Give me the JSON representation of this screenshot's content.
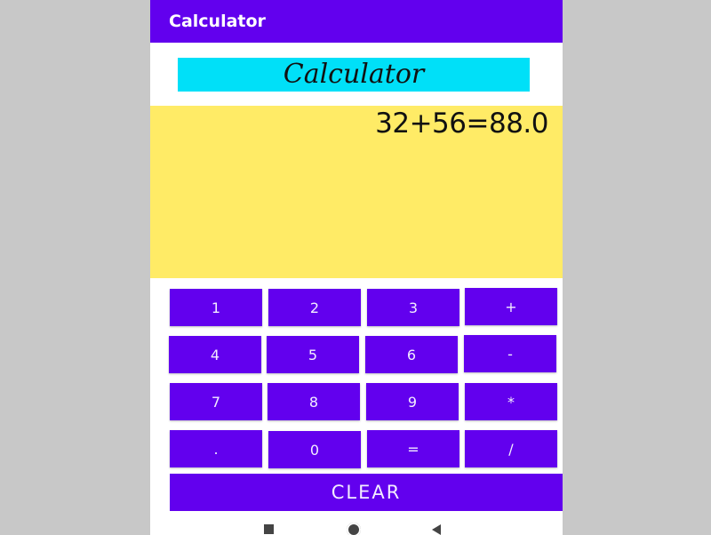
{
  "appbar": {
    "title": "Calculator"
  },
  "header": {
    "label": "Calculator"
  },
  "display": {
    "expression": "32+56=88.0"
  },
  "keypad": {
    "keys": [
      "1",
      "2",
      "3",
      "+",
      "4",
      "5",
      "6",
      "-",
      "7",
      "8",
      "9",
      "*",
      ".",
      "0",
      "=",
      "/"
    ],
    "clear_label": "CLEAR"
  },
  "colors": {
    "appbar": "#6200ee",
    "title_bg": "#00e0f8",
    "display_bg": "#ffeb66",
    "key_bg": "#6200ee"
  },
  "icons": {
    "nav_recents": "recents-square-icon",
    "nav_home": "home-circle-icon",
    "nav_back": "back-triangle-icon"
  }
}
